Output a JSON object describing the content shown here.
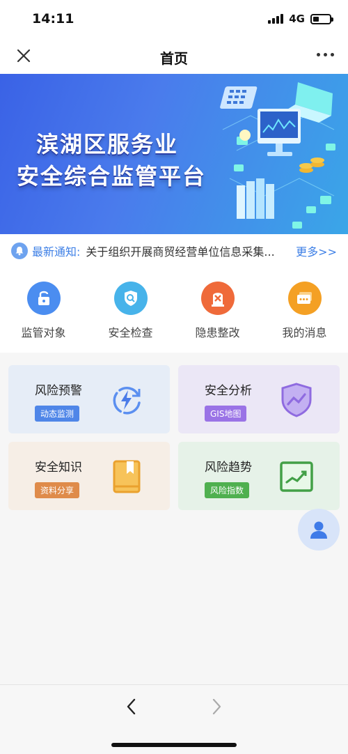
{
  "status": {
    "time": "14:11",
    "network": "4G",
    "battery_level": 0.35
  },
  "nav": {
    "title": "首页",
    "close_icon": "close-icon",
    "more_icon": "more-dots-icon"
  },
  "banner": {
    "line1": "滨湖区服务业",
    "line2": "安全综合监管平台"
  },
  "notice": {
    "label": "最新通知:",
    "text": "关于组织开展商贸经营单位信息采集...",
    "more": "更多>>"
  },
  "quick": [
    {
      "label": "监管对象",
      "icon": "lock-icon",
      "color": "#4b8df0"
    },
    {
      "label": "安全检查",
      "icon": "shield-search-icon",
      "color": "#47b3ea"
    },
    {
      "label": "隐患整改",
      "icon": "repair-icon",
      "color": "#ef6a3a"
    },
    {
      "label": "我的消息",
      "icon": "message-icon",
      "color": "#f4a024"
    }
  ],
  "cards": [
    {
      "title": "风险预警",
      "tag": "动态监测",
      "tag_color": "#4f86e8",
      "bg": "#e6edf7",
      "icon": "lightning-refresh-icon"
    },
    {
      "title": "安全分析",
      "tag": "GIS地图",
      "tag_color": "#9a73e6",
      "bg": "#ebe7f6",
      "icon": "shield-chart-icon"
    },
    {
      "title": "安全知识",
      "tag": "资料分享",
      "tag_color": "#df8b4a",
      "bg": "#f6eee6",
      "icon": "book-icon"
    },
    {
      "title": "风险趋势",
      "tag": "风险指数",
      "tag_color": "#4fb04f",
      "bg": "#e6f2e8",
      "icon": "trend-chart-icon"
    }
  ],
  "float": {
    "icon": "user-icon"
  },
  "bottom": {
    "back_icon": "chevron-left-icon",
    "forward_icon": "chevron-right-icon"
  }
}
